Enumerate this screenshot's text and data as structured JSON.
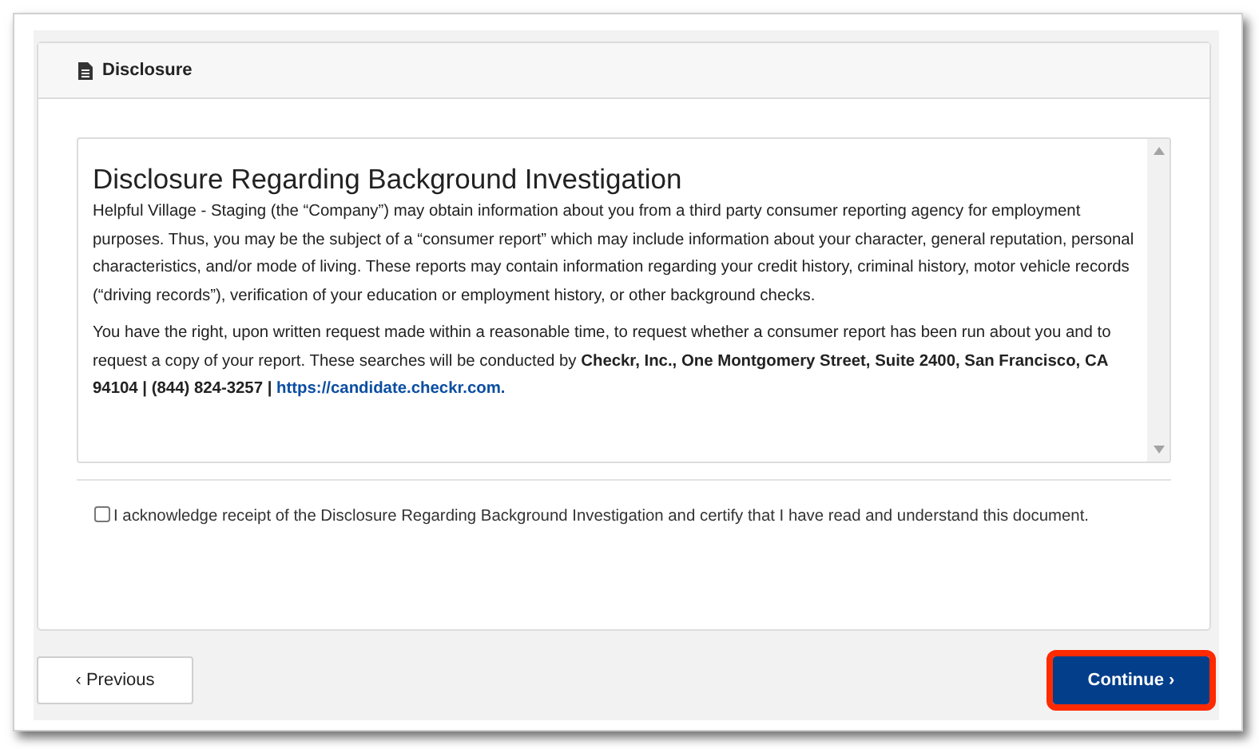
{
  "card": {
    "title": "Disclosure"
  },
  "disclosure": {
    "heading": "Disclosure Regarding Background Investigation",
    "paragraphs": [
      {
        "text": "Helpful Village - Staging (the “Company”) may obtain information about you from a third party consumer reporting agency for employment purposes. Thus, you may be the subject of a “consumer report” which may include information about your character, general reputation, personal characteristics, and/or mode of living. These reports may contain information regarding your credit history, criminal history, motor vehicle records (“driving records”), verification of your education or employment history, or other background checks."
      },
      {
        "text": "You have the right, upon written request made within a reasonable time, to request whether a consumer report has been run about you and to request a copy of your report. These searches will be conducted by **Checkr, Inc., One Montgomery Street, Suite 2400, San Francisco, CA 94104 | (844) 824-3257 |** ",
        "link": "https://candidate.checkr.com."
      }
    ]
  },
  "acknowledge": {
    "checked": false,
    "label": "I acknowledge receipt of the Disclosure Regarding Background Investigation and certify that I have read and understand this document."
  },
  "buttons": [
    {
      "kind": "secondary",
      "label": "‹ Previous"
    },
    {
      "kind": "primary",
      "label": "Continue ›",
      "highlighted": true
    }
  ]
}
